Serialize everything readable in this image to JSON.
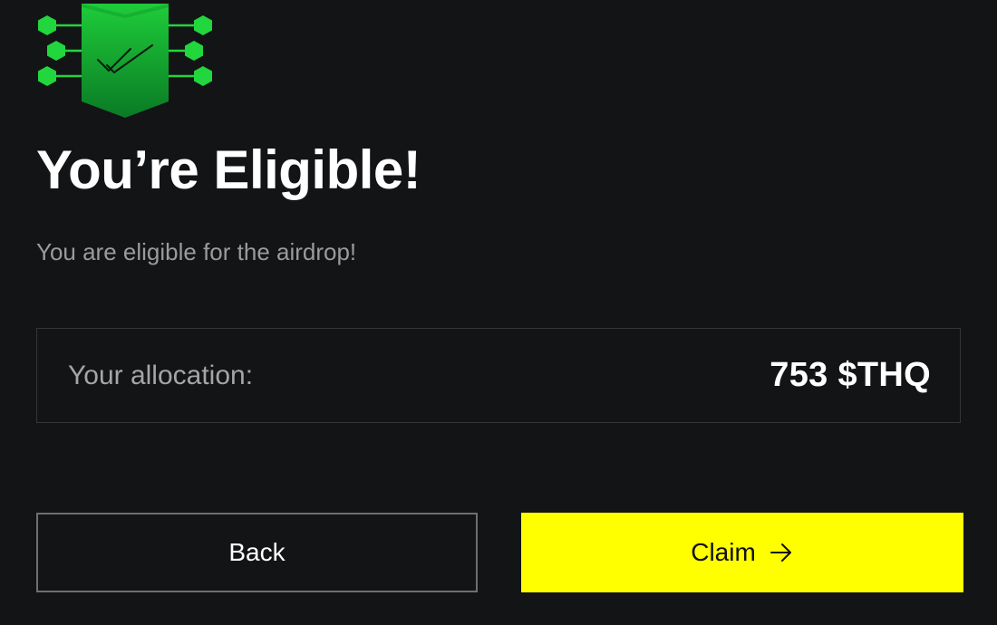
{
  "header": {
    "title": "You’re Eligible!",
    "subtitle": "You are eligible for the airdrop!"
  },
  "badge": {
    "icon": "shield-check-icon",
    "accent_color": "#22d63d"
  },
  "allocation": {
    "label": "Your allocation:",
    "value": "753 $THQ"
  },
  "actions": {
    "back_label": "Back",
    "claim_label": "Claim",
    "claim_color": "#ffff00",
    "claim_icon": "arrow-right-icon"
  }
}
